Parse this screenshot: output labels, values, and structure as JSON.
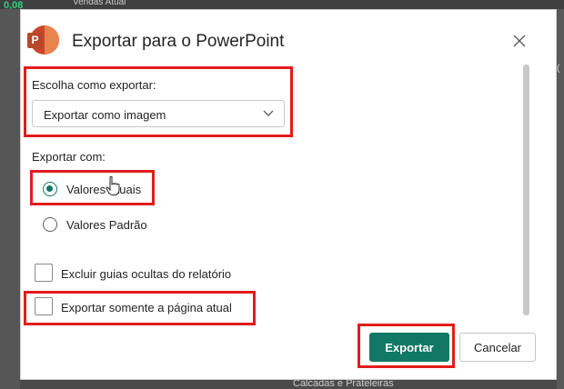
{
  "background": {
    "top_value": "0,08",
    "top_caption": "Vendas Atual",
    "right_glyph": "(",
    "bottom_text": "Calcadas e Prateleiras"
  },
  "dialog": {
    "logo_letter": "P",
    "title": "Exportar para o PowerPoint",
    "close_icon": "close-icon",
    "export_how_label": "Escolha como exportar:",
    "export_how_value": "Exportar como imagem",
    "export_with_label": "Exportar com:",
    "options": [
      {
        "label": "Valores Atuais",
        "checked": true
      },
      {
        "label": "Valores Padrão",
        "checked": false
      }
    ],
    "checkboxes": [
      {
        "label": "Excluir guias ocultas do relatório",
        "checked": false
      },
      {
        "label": "Exportar somente a página atual",
        "checked": false
      }
    ],
    "export_button": "Exportar",
    "cancel_button": "Cancelar"
  },
  "colors": {
    "accent": "#117865",
    "highlight": "#e21c1c",
    "logo": "#c9462c"
  }
}
